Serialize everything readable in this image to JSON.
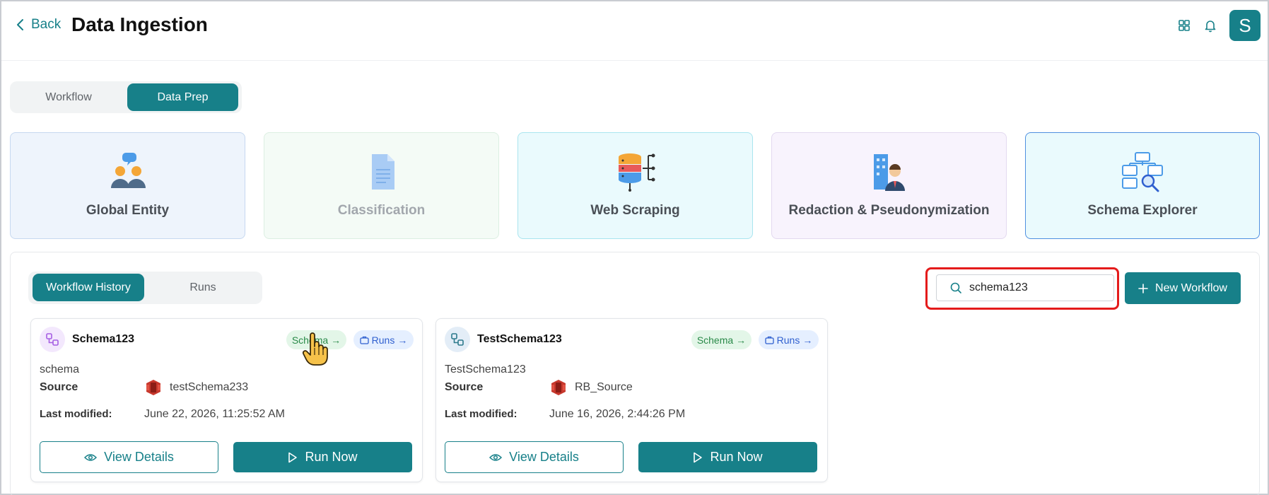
{
  "header": {
    "back_label": "Back",
    "title": "Data Ingestion",
    "icons": [
      "grid-icon",
      "bell-icon"
    ],
    "avatar_letter": "S"
  },
  "top_tabs": [
    {
      "label": "Workflow",
      "active": false
    },
    {
      "label": "Data Prep",
      "active": true
    }
  ],
  "feature_cards": [
    {
      "label": "Global Entity",
      "icon": "people-chat-icon"
    },
    {
      "label": "Classification",
      "icon": "document-icon",
      "disabled": true
    },
    {
      "label": "Web Scraping",
      "icon": "database-network-icon"
    },
    {
      "label": "Redaction & Pseudonymization",
      "icon": "person-building-icon"
    },
    {
      "label": "Schema Explorer",
      "icon": "schema-search-icon",
      "selected": true
    }
  ],
  "history_tabs": [
    {
      "label": "Workflow History",
      "active": true
    },
    {
      "label": "Runs",
      "active": false
    }
  ],
  "search": {
    "value": "schema123",
    "placeholder": ""
  },
  "new_workflow_label": "New Workflow",
  "workflows": [
    {
      "name": "Schema123",
      "schema_pill": "Schema",
      "runs_pill": "Runs",
      "type": "schema",
      "source_label": "Source",
      "source_value": "testSchema233",
      "modified_label": "Last modified:",
      "modified_value": "June 22, 2026, 11:25:52 AM",
      "view_label": "View Details",
      "run_label": "Run Now"
    },
    {
      "name": "TestSchema123",
      "schema_pill": "Schema",
      "runs_pill": "Runs",
      "type": "TestSchema123",
      "source_label": "Source",
      "source_value": "RB_Source",
      "modified_label": "Last modified:",
      "modified_value": "June 16, 2026, 2:44:26 PM",
      "view_label": "View Details",
      "run_label": "Run Now"
    }
  ],
  "colors": {
    "accent": "#178089",
    "highlight": "#e41b1b",
    "schema_pill_bg": "#e3f6e8",
    "runs_pill_bg": "#e5efff"
  }
}
